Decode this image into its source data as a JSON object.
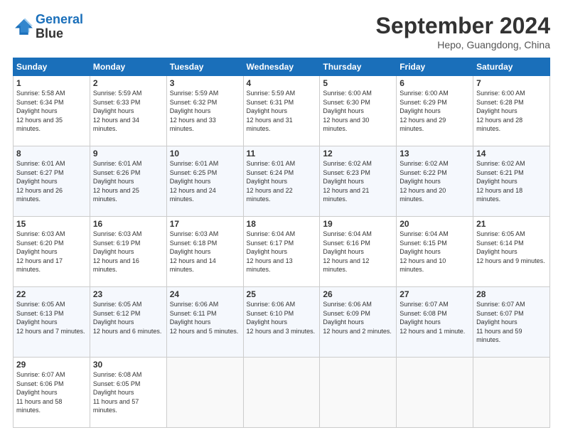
{
  "logo": {
    "line1": "General",
    "line2": "Blue"
  },
  "title": "September 2024",
  "location": "Hepo, Guangdong, China",
  "days_of_week": [
    "Sunday",
    "Monday",
    "Tuesday",
    "Wednesday",
    "Thursday",
    "Friday",
    "Saturday"
  ],
  "weeks": [
    [
      {
        "day": "1",
        "sunrise": "5:58 AM",
        "sunset": "6:34 PM",
        "daylight": "12 hours and 35 minutes."
      },
      {
        "day": "2",
        "sunrise": "5:59 AM",
        "sunset": "6:33 PM",
        "daylight": "12 hours and 34 minutes."
      },
      {
        "day": "3",
        "sunrise": "5:59 AM",
        "sunset": "6:32 PM",
        "daylight": "12 hours and 33 minutes."
      },
      {
        "day": "4",
        "sunrise": "5:59 AM",
        "sunset": "6:31 PM",
        "daylight": "12 hours and 31 minutes."
      },
      {
        "day": "5",
        "sunrise": "6:00 AM",
        "sunset": "6:30 PM",
        "daylight": "12 hours and 30 minutes."
      },
      {
        "day": "6",
        "sunrise": "6:00 AM",
        "sunset": "6:29 PM",
        "daylight": "12 hours and 29 minutes."
      },
      {
        "day": "7",
        "sunrise": "6:00 AM",
        "sunset": "6:28 PM",
        "daylight": "12 hours and 28 minutes."
      }
    ],
    [
      {
        "day": "8",
        "sunrise": "6:01 AM",
        "sunset": "6:27 PM",
        "daylight": "12 hours and 26 minutes."
      },
      {
        "day": "9",
        "sunrise": "6:01 AM",
        "sunset": "6:26 PM",
        "daylight": "12 hours and 25 minutes."
      },
      {
        "day": "10",
        "sunrise": "6:01 AM",
        "sunset": "6:25 PM",
        "daylight": "12 hours and 24 minutes."
      },
      {
        "day": "11",
        "sunrise": "6:01 AM",
        "sunset": "6:24 PM",
        "daylight": "12 hours and 22 minutes."
      },
      {
        "day": "12",
        "sunrise": "6:02 AM",
        "sunset": "6:23 PM",
        "daylight": "12 hours and 21 minutes."
      },
      {
        "day": "13",
        "sunrise": "6:02 AM",
        "sunset": "6:22 PM",
        "daylight": "12 hours and 20 minutes."
      },
      {
        "day": "14",
        "sunrise": "6:02 AM",
        "sunset": "6:21 PM",
        "daylight": "12 hours and 18 minutes."
      }
    ],
    [
      {
        "day": "15",
        "sunrise": "6:03 AM",
        "sunset": "6:20 PM",
        "daylight": "12 hours and 17 minutes."
      },
      {
        "day": "16",
        "sunrise": "6:03 AM",
        "sunset": "6:19 PM",
        "daylight": "12 hours and 16 minutes."
      },
      {
        "day": "17",
        "sunrise": "6:03 AM",
        "sunset": "6:18 PM",
        "daylight": "12 hours and 14 minutes."
      },
      {
        "day": "18",
        "sunrise": "6:04 AM",
        "sunset": "6:17 PM",
        "daylight": "12 hours and 13 minutes."
      },
      {
        "day": "19",
        "sunrise": "6:04 AM",
        "sunset": "6:16 PM",
        "daylight": "12 hours and 12 minutes."
      },
      {
        "day": "20",
        "sunrise": "6:04 AM",
        "sunset": "6:15 PM",
        "daylight": "12 hours and 10 minutes."
      },
      {
        "day": "21",
        "sunrise": "6:05 AM",
        "sunset": "6:14 PM",
        "daylight": "12 hours and 9 minutes."
      }
    ],
    [
      {
        "day": "22",
        "sunrise": "6:05 AM",
        "sunset": "6:13 PM",
        "daylight": "12 hours and 7 minutes."
      },
      {
        "day": "23",
        "sunrise": "6:05 AM",
        "sunset": "6:12 PM",
        "daylight": "12 hours and 6 minutes."
      },
      {
        "day": "24",
        "sunrise": "6:06 AM",
        "sunset": "6:11 PM",
        "daylight": "12 hours and 5 minutes."
      },
      {
        "day": "25",
        "sunrise": "6:06 AM",
        "sunset": "6:10 PM",
        "daylight": "12 hours and 3 minutes."
      },
      {
        "day": "26",
        "sunrise": "6:06 AM",
        "sunset": "6:09 PM",
        "daylight": "12 hours and 2 minutes."
      },
      {
        "day": "27",
        "sunrise": "6:07 AM",
        "sunset": "6:08 PM",
        "daylight": "12 hours and 1 minute."
      },
      {
        "day": "28",
        "sunrise": "6:07 AM",
        "sunset": "6:07 PM",
        "daylight": "11 hours and 59 minutes."
      }
    ],
    [
      {
        "day": "29",
        "sunrise": "6:07 AM",
        "sunset": "6:06 PM",
        "daylight": "11 hours and 58 minutes."
      },
      {
        "day": "30",
        "sunrise": "6:08 AM",
        "sunset": "6:05 PM",
        "daylight": "11 hours and 57 minutes."
      },
      {
        "day": "",
        "sunrise": "",
        "sunset": "",
        "daylight": ""
      },
      {
        "day": "",
        "sunrise": "",
        "sunset": "",
        "daylight": ""
      },
      {
        "day": "",
        "sunrise": "",
        "sunset": "",
        "daylight": ""
      },
      {
        "day": "",
        "sunrise": "",
        "sunset": "",
        "daylight": ""
      },
      {
        "day": "",
        "sunrise": "",
        "sunset": "",
        "daylight": ""
      }
    ]
  ]
}
